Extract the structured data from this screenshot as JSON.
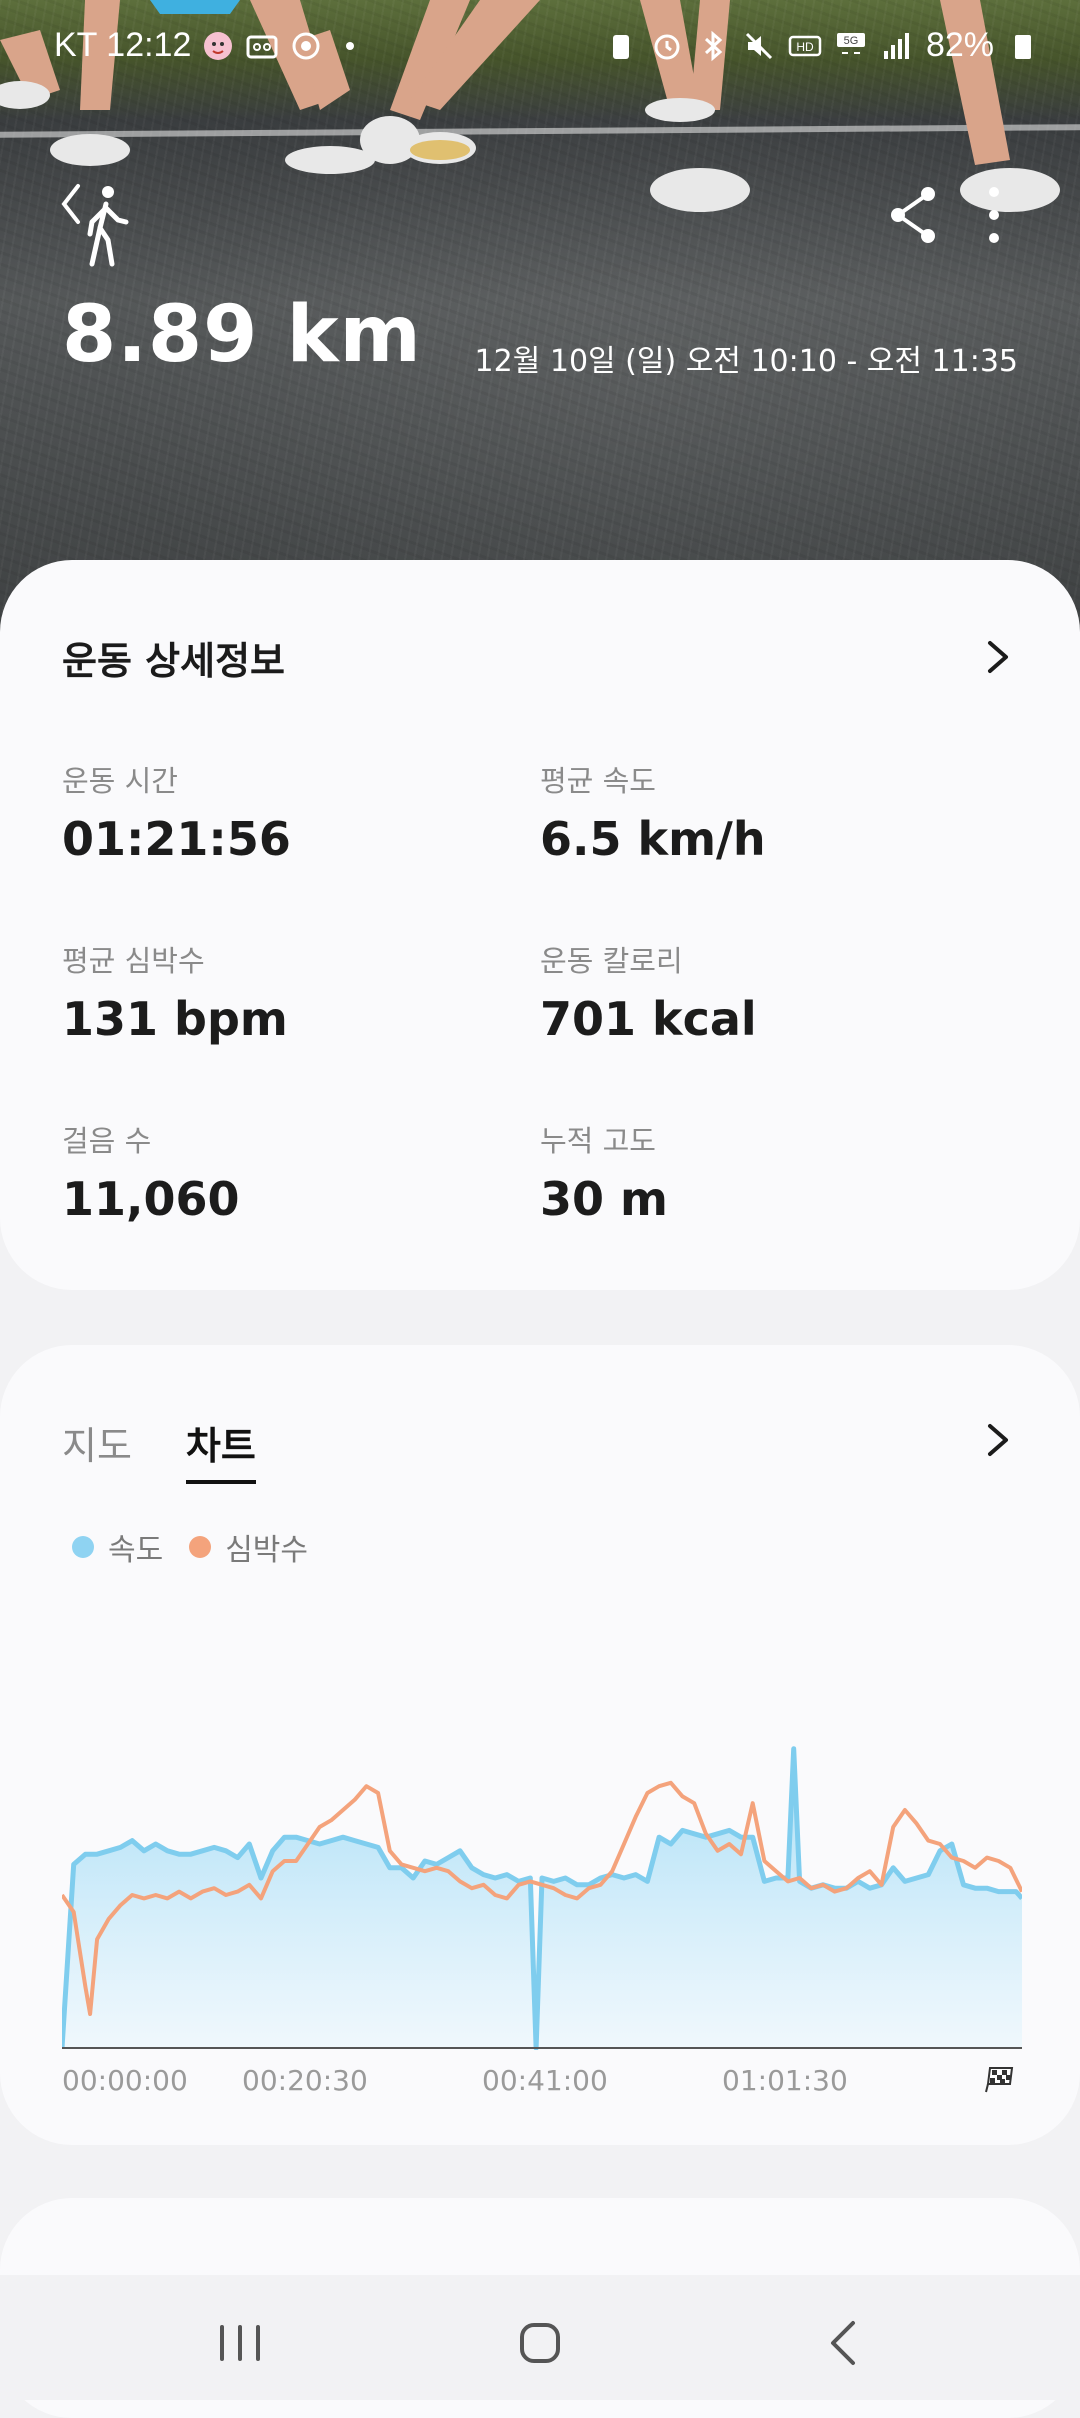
{
  "status_bar": {
    "carrier_time": "KT 12:12",
    "battery": "82%",
    "icons": [
      "weather-icon",
      "voicemail-icon",
      "record-icon",
      "dot-icon",
      "battery-saver-icon",
      "alarm-icon",
      "bluetooth-icon",
      "mute-icon",
      "hd-icon",
      "5g-icon",
      "signal-icon",
      "battery-icon"
    ]
  },
  "header": {
    "activity_icon": "walking-person-icon",
    "distance": "8.89 km",
    "datetime": "12월 10일 (일) 오전 10:10 - 오전 11:35"
  },
  "details": {
    "title": "운동 상세정보",
    "stats": [
      {
        "label": "운동 시간",
        "value": "01:21:56"
      },
      {
        "label": "평균 속도",
        "value": "6.5 km/h"
      },
      {
        "label": "평균 심박수",
        "value": "131 bpm"
      },
      {
        "label": "운동 칼로리",
        "value": "701 kcal"
      },
      {
        "label": "걸음 수",
        "value": "11,060"
      },
      {
        "label": "누적 고도",
        "value": "30 m"
      }
    ]
  },
  "chart_section": {
    "tabs": [
      {
        "label": "지도",
        "active": false
      },
      {
        "label": "차트",
        "active": true
      }
    ],
    "legend": [
      {
        "label": "속도",
        "color": "#8fd3f2"
      },
      {
        "label": "심박수",
        "color": "#f4a37c"
      }
    ]
  },
  "chart_data": {
    "type": "area",
    "x_tick_labels": [
      "00:00:00",
      "00:20:30",
      "00:41:00",
      "01:01:30"
    ],
    "x_range_minutes": [
      0,
      82
    ],
    "series": [
      {
        "name": "속도",
        "style": "area",
        "color": "#8fd3f2",
        "x_minutes": [
          0,
          1,
          2,
          3,
          4,
          5,
          6,
          7,
          8,
          9,
          10,
          11,
          12,
          13,
          14,
          15,
          16,
          17,
          18,
          19,
          20,
          21,
          22,
          23,
          24,
          25,
          26,
          27,
          28,
          29,
          30,
          31,
          32,
          33,
          34,
          35,
          36,
          37,
          38,
          39,
          40,
          40.5,
          41,
          42,
          43,
          44,
          45,
          46,
          47,
          48,
          49,
          50,
          51,
          52,
          53,
          54,
          55,
          56,
          57,
          58,
          59,
          60,
          61,
          62,
          62.5,
          63,
          64,
          65,
          66,
          67,
          68,
          69,
          70,
          71,
          72,
          73,
          74,
          75,
          76,
          77,
          78,
          79,
          80,
          81,
          81.5,
          82
        ],
        "values": [
          0,
          0.54,
          0.57,
          0.57,
          0.58,
          0.59,
          0.61,
          0.58,
          0.6,
          0.58,
          0.57,
          0.57,
          0.58,
          0.59,
          0.58,
          0.56,
          0.6,
          0.5,
          0.58,
          0.62,
          0.62,
          0.61,
          0.6,
          0.61,
          0.62,
          0.61,
          0.6,
          0.59,
          0.53,
          0.53,
          0.5,
          0.55,
          0.54,
          0.56,
          0.58,
          0.53,
          0.51,
          0.5,
          0.51,
          0.49,
          0.5,
          0,
          0.5,
          0.49,
          0.5,
          0.48,
          0.48,
          0.5,
          0.51,
          0.5,
          0.51,
          0.49,
          0.62,
          0.6,
          0.64,
          0.63,
          0.62,
          0.63,
          0.64,
          0.62,
          0.62,
          0.49,
          0.5,
          0.5,
          0.88,
          0.49,
          0.47,
          0.48,
          0.47,
          0.47,
          0.49,
          0.47,
          0.48,
          0.53,
          0.49,
          0.5,
          0.51,
          0.58,
          0.6,
          0.48,
          0.47,
          0.47,
          0.46,
          0.46,
          0.46,
          0.44,
          0
        ]
      },
      {
        "name": "심박수",
        "style": "line",
        "color": "#f4a37c",
        "x_minutes": [
          0,
          1,
          2,
          2.4,
          3,
          4,
          5,
          6,
          7,
          8,
          9,
          10,
          11,
          12,
          13,
          14,
          15,
          16,
          17,
          18,
          19,
          20,
          21,
          22,
          23,
          24,
          25,
          26,
          27,
          28,
          29,
          30,
          31,
          32,
          33,
          34,
          35,
          36,
          37,
          38,
          39,
          40,
          41,
          42,
          43,
          44,
          45,
          46,
          47,
          48,
          49,
          50,
          51,
          52,
          53,
          54,
          55,
          56,
          57,
          58,
          59,
          60,
          61,
          62,
          63,
          64,
          65,
          66,
          67,
          68,
          69,
          70,
          71,
          72,
          73,
          74,
          75,
          76,
          77,
          78,
          79,
          80,
          81,
          82
        ],
        "values": [
          0.45,
          0.4,
          0.18,
          0.1,
          0.32,
          0.38,
          0.42,
          0.45,
          0.44,
          0.45,
          0.44,
          0.46,
          0.44,
          0.46,
          0.47,
          0.45,
          0.46,
          0.48,
          0.44,
          0.52,
          0.55,
          0.55,
          0.6,
          0.65,
          0.67,
          0.7,
          0.73,
          0.77,
          0.75,
          0.58,
          0.54,
          0.53,
          0.52,
          0.53,
          0.52,
          0.49,
          0.47,
          0.48,
          0.45,
          0.44,
          0.48,
          0.49,
          0.48,
          0.47,
          0.45,
          0.44,
          0.47,
          0.48,
          0.52,
          0.6,
          0.68,
          0.75,
          0.77,
          0.78,
          0.74,
          0.72,
          0.63,
          0.58,
          0.6,
          0.57,
          0.72,
          0.55,
          0.52,
          0.49,
          0.5,
          0.47,
          0.48,
          0.46,
          0.47,
          0.5,
          0.52,
          0.48,
          0.65,
          0.7,
          0.66,
          0.61,
          0.6,
          0.56,
          0.55,
          0.53,
          0.56,
          0.55,
          0.53,
          0.46
        ]
      }
    ]
  },
  "nav_bar": {
    "icons": [
      "recent-apps-icon",
      "home-icon",
      "back-icon"
    ]
  }
}
